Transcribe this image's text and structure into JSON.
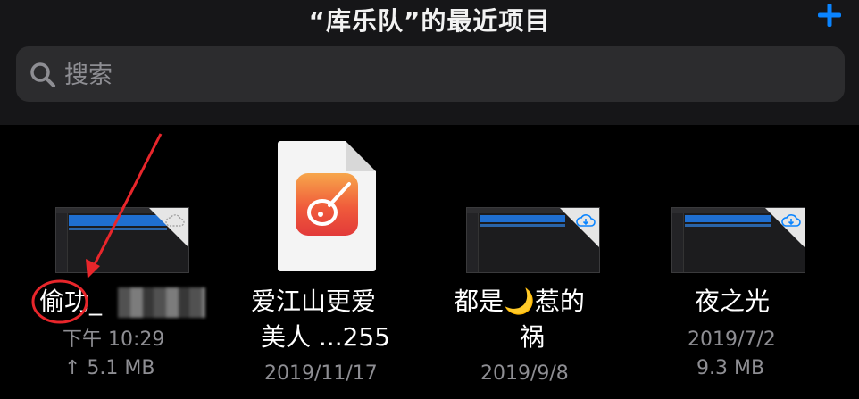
{
  "header": {
    "title": "“库乐队”的最近项目",
    "add_icon": "plus-icon"
  },
  "search": {
    "placeholder": "搜索",
    "icon": "search-icon"
  },
  "items": [
    {
      "name": "偷功_",
      "time": "下午 10:29",
      "size": "↑ 5.1 MB",
      "type": "project",
      "annotation": "red circle around name, red arrow pointing at name"
    },
    {
      "name_line1": "爱江山更爱",
      "name_line2": "美人 ...255",
      "date": "2019/11/17",
      "type": "garageband-document"
    },
    {
      "name_line1": "都是🌙惹的",
      "name_line2": "祸",
      "date": "2019/9/8",
      "type": "project-cloud"
    },
    {
      "name": "夜之光",
      "date": "2019/7/2",
      "size": "9.3 MB",
      "type": "project-cloud"
    }
  ],
  "colors": {
    "accent": "#0a84ff",
    "annotation": "#e8262b",
    "secondary_text": "#8e8e93",
    "header_bg": "#161618",
    "search_bg": "#2c2c2e"
  }
}
